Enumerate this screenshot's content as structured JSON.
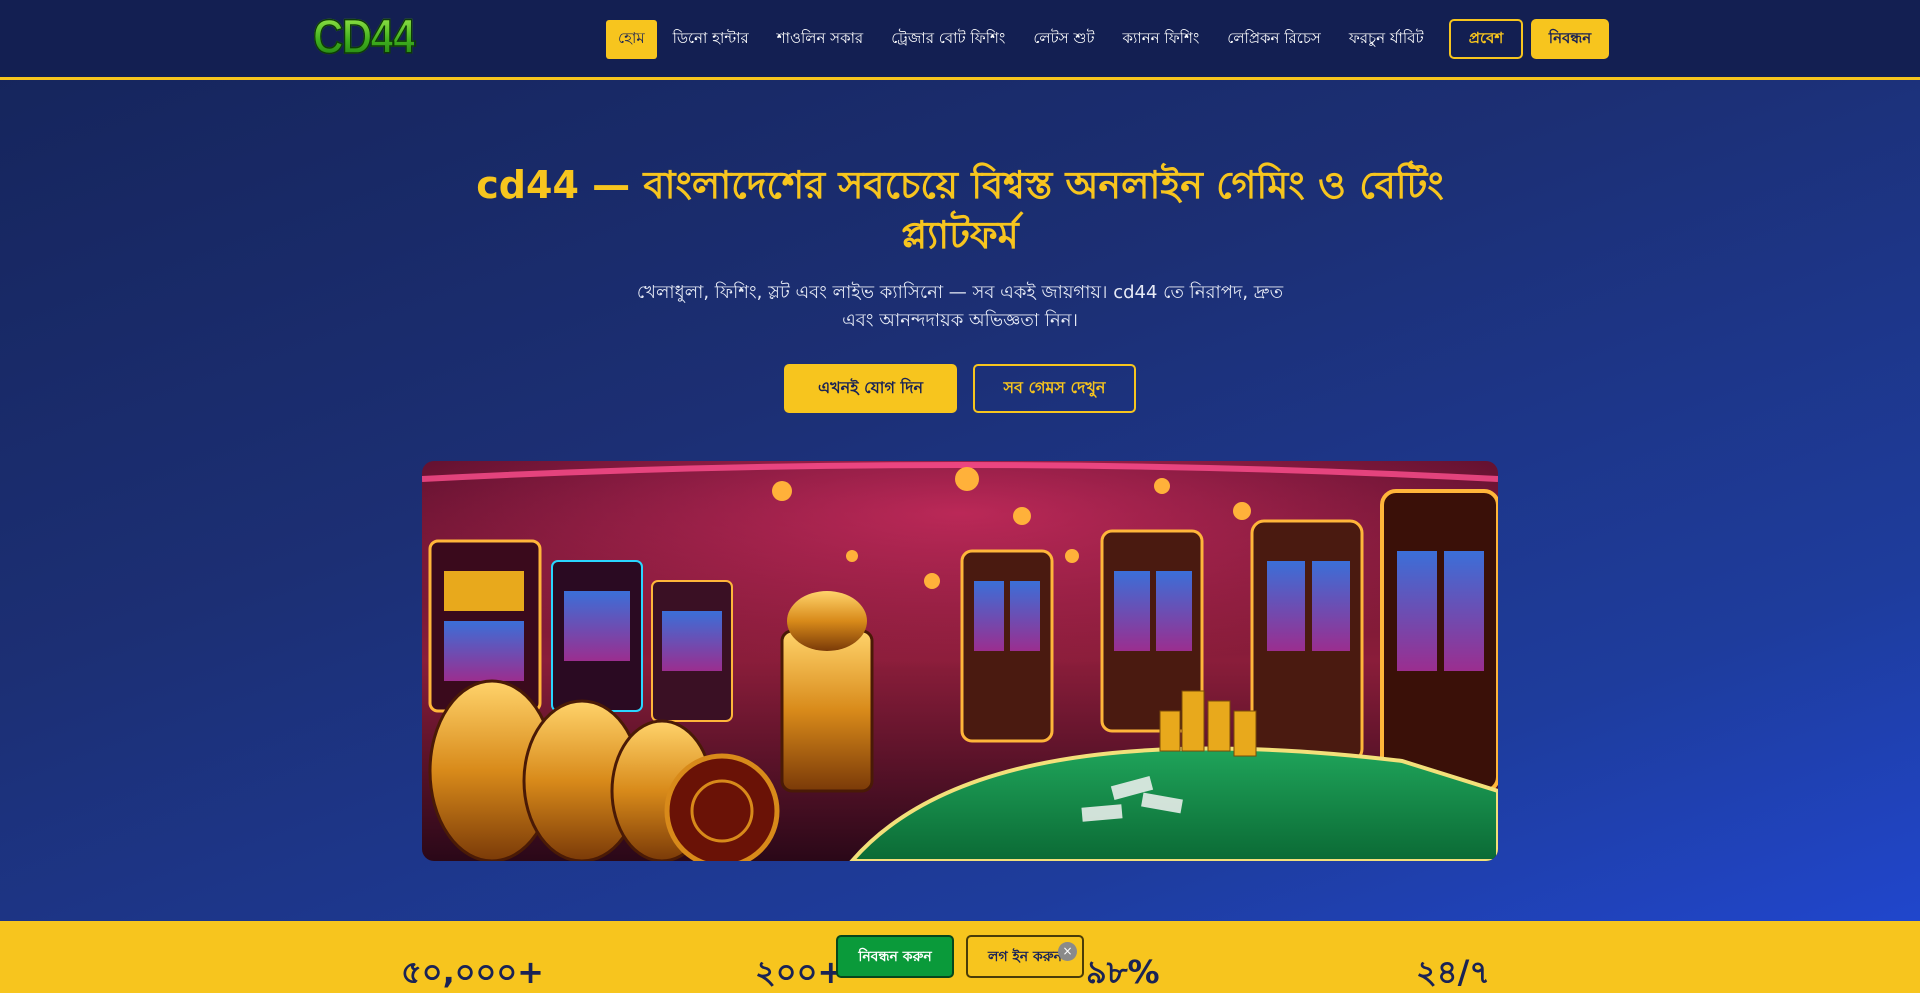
{
  "header": {
    "logo": "CD44",
    "nav": [
      {
        "label": "হোম",
        "active": true
      },
      {
        "label": "ডিনো হান্টার",
        "active": false
      },
      {
        "label": "শাওলিন সকার",
        "active": false
      },
      {
        "label": "ট্রেজার বোট ফিশিং",
        "active": false
      },
      {
        "label": "লেটস শুট",
        "active": false
      },
      {
        "label": "ক্যানন ফিশিং",
        "active": false
      },
      {
        "label": "লেপ্রিকন রিচেস",
        "active": false
      },
      {
        "label": "ফরচুন র্যাবিট",
        "active": false
      }
    ],
    "login_label": "প্রবেশ",
    "register_label": "নিবন্ধন"
  },
  "hero": {
    "title": "cd44 — বাংলাদেশের সবচেয়ে বিশ্বস্ত অনলাইন গেমিং ও বেটিং প্ল্যাটফর্ম",
    "subtitle": "খেলাধুলা, ফিশিং, স্লট এবং লাইভ ক্যাসিনো — সব একই জায়গায়। cd44 তে নিরাপদ, দ্রুত এবং আনন্দদায়ক অভিজ্ঞতা নিন।",
    "cta_join": "এখনই যোগ দিন",
    "cta_games": "সব গেমস দেখুন"
  },
  "stats": [
    {
      "value": "৫০,০০০+"
    },
    {
      "value": "২০০+"
    },
    {
      "value": "৯৮%"
    },
    {
      "value": "২৪/৭"
    }
  ],
  "floating_bar": {
    "register_label": "নিবন্ধন করুন",
    "login_label": "লগ ইন করুন",
    "close_icon": "×"
  },
  "colors": {
    "accent": "#f7c51e",
    "header_bg": "#131f52",
    "register_green": "#0a9a3a"
  }
}
